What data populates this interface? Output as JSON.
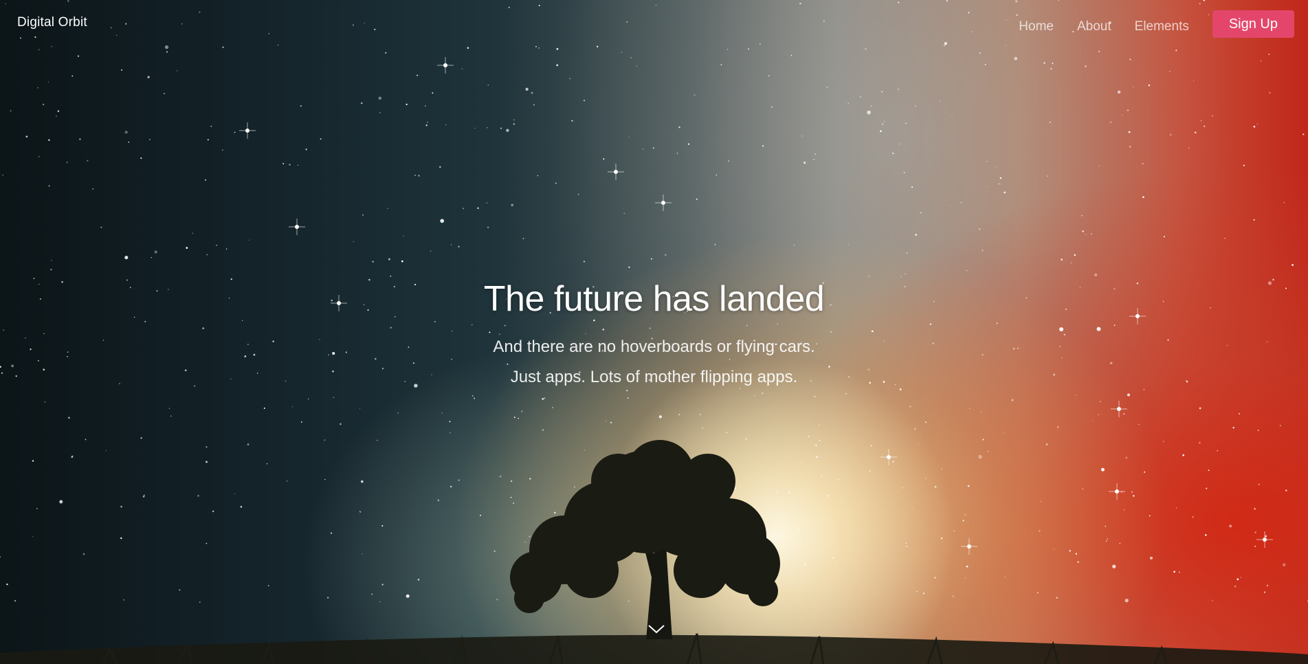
{
  "nav": {
    "brand": "Digital Orbit",
    "links": [
      "Home",
      "About",
      "Elements"
    ],
    "signup_label": "Sign Up",
    "accent": "#e4466b"
  },
  "hero": {
    "title": "The future has landed",
    "line1": "And there are no hoverboards or flying cars.",
    "line2": "Just apps. Lots of mother flipping apps.",
    "scroll_icon": "chevron-down-icon"
  }
}
